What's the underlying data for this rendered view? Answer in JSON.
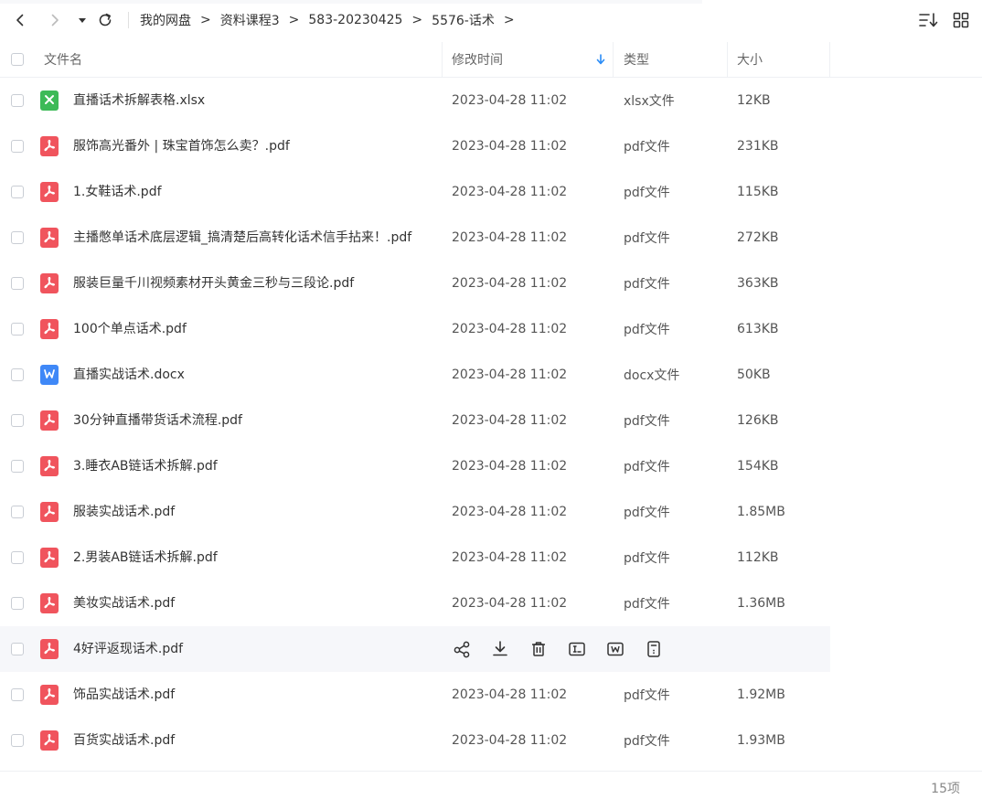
{
  "breadcrumb": [
    "我的网盘",
    "资料课程3",
    "583-20230425",
    "5576-话术"
  ],
  "breadcrumb_sep": ">",
  "columns": {
    "name": "文件名",
    "modified": "修改时间",
    "type": "类型",
    "size": "大小"
  },
  "sort": {
    "column": "modified",
    "direction": "desc"
  },
  "files": [
    {
      "name": "直播话术拆解表格.xlsx",
      "time": "2023-04-28 11:02",
      "type": "xlsx文件",
      "size": "12KB",
      "icon": "xlsx-file-icon"
    },
    {
      "name": "服饰高光番外 | 珠宝首饰怎么卖？.pdf",
      "time": "2023-04-28 11:02",
      "type": "pdf文件",
      "size": "231KB",
      "icon": "pdf-file-icon"
    },
    {
      "name": "1.女鞋话术.pdf",
      "time": "2023-04-28 11:02",
      "type": "pdf文件",
      "size": "115KB",
      "icon": "pdf-file-icon"
    },
    {
      "name": "主播憋单话术底层逻辑_搞清楚后高转化话术信手拈来！.pdf",
      "time": "2023-04-28 11:02",
      "type": "pdf文件",
      "size": "272KB",
      "icon": "pdf-file-icon"
    },
    {
      "name": "服装巨量千川视频素材开头黄金三秒与三段论.pdf",
      "time": "2023-04-28 11:02",
      "type": "pdf文件",
      "size": "363KB",
      "icon": "pdf-file-icon"
    },
    {
      "name": "100个单点话术.pdf",
      "time": "2023-04-28 11:02",
      "type": "pdf文件",
      "size": "613KB",
      "icon": "pdf-file-icon"
    },
    {
      "name": "直播实战话术.docx",
      "time": "2023-04-28 11:02",
      "type": "docx文件",
      "size": "50KB",
      "icon": "docx-file-icon"
    },
    {
      "name": "30分钟直播带货话术流程.pdf",
      "time": "2023-04-28 11:02",
      "type": "pdf文件",
      "size": "126KB",
      "icon": "pdf-file-icon"
    },
    {
      "name": "3.睡衣AB链话术拆解.pdf",
      "time": "2023-04-28 11:02",
      "type": "pdf文件",
      "size": "154KB",
      "icon": "pdf-file-icon"
    },
    {
      "name": "服装实战话术.pdf",
      "time": "2023-04-28 11:02",
      "type": "pdf文件",
      "size": "1.85MB",
      "icon": "pdf-file-icon"
    },
    {
      "name": "2.男装AB链话术拆解.pdf",
      "time": "2023-04-28 11:02",
      "type": "pdf文件",
      "size": "112KB",
      "icon": "pdf-file-icon"
    },
    {
      "name": "美妆实战话术.pdf",
      "time": "2023-04-28 11:02",
      "type": "pdf文件",
      "size": "1.36MB",
      "icon": "pdf-file-icon"
    },
    {
      "name": "4好评返现话术.pdf",
      "time": "",
      "type": "",
      "size": "",
      "icon": "pdf-file-icon",
      "hover": true
    },
    {
      "name": "饰品实战话术.pdf",
      "time": "2023-04-28 11:02",
      "type": "pdf文件",
      "size": "1.92MB",
      "icon": "pdf-file-icon"
    },
    {
      "name": "百货实战话术.pdf",
      "time": "2023-04-28 11:02",
      "type": "pdf文件",
      "size": "1.93MB",
      "icon": "pdf-file-icon"
    }
  ],
  "row_actions": [
    "share-icon",
    "download-icon",
    "delete-icon",
    "rename-icon",
    "open-with-icon",
    "details-icon"
  ],
  "footer": {
    "count": "15项"
  },
  "colors": {
    "pdf": "#f0545d",
    "xlsx": "#3dba57",
    "docx": "#3f88f7",
    "accent": "#2a8cf7"
  }
}
